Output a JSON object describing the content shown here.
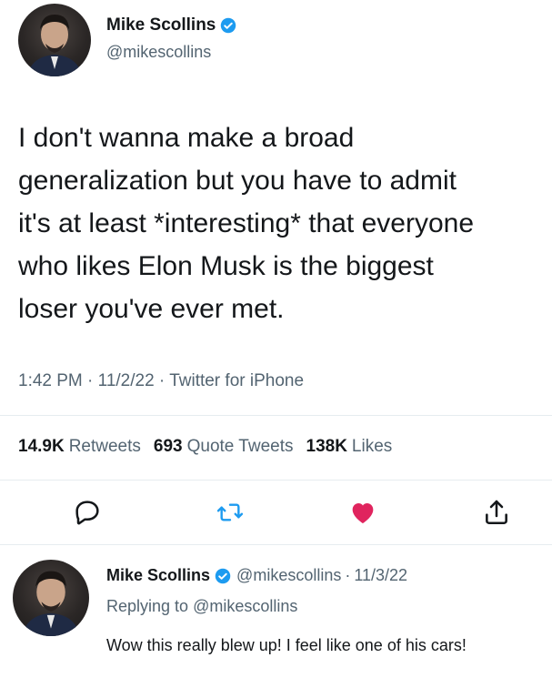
{
  "tweet": {
    "author": {
      "display_name": "Mike Scollins",
      "handle": "@mikescollins",
      "verified": true
    },
    "text_lines": [
      "I don't wanna make a broad",
      "generalization but you have to admit",
      "it's at least *interesting* that everyone",
      "who likes Elon Musk is the biggest",
      "loser you've ever met."
    ],
    "time": "1:42 PM",
    "date": "11/2/22",
    "source": "Twitter for iPhone",
    "stats": {
      "retweets_count": "14.9K",
      "retweets_label": "Retweets",
      "quotes_count": "693",
      "quotes_label": "Quote Tweets",
      "likes_count": "138K",
      "likes_label": "Likes"
    },
    "actions": {
      "reply_icon": "comment-icon",
      "retweet_icon": "retweet-icon",
      "like_icon": "heart-icon",
      "share_icon": "share-icon"
    },
    "like_color": "#e0245e",
    "accent_color": "#1d9bf0"
  },
  "reply": {
    "author": {
      "display_name": "Mike Scollins",
      "handle": "@mikescollins",
      "verified": true
    },
    "date": "11/3/22",
    "replying_to_prefix": "Replying to",
    "replying_to_handle": "@mikescollins",
    "text": "Wow this really blew up! I feel like one of his cars!"
  }
}
